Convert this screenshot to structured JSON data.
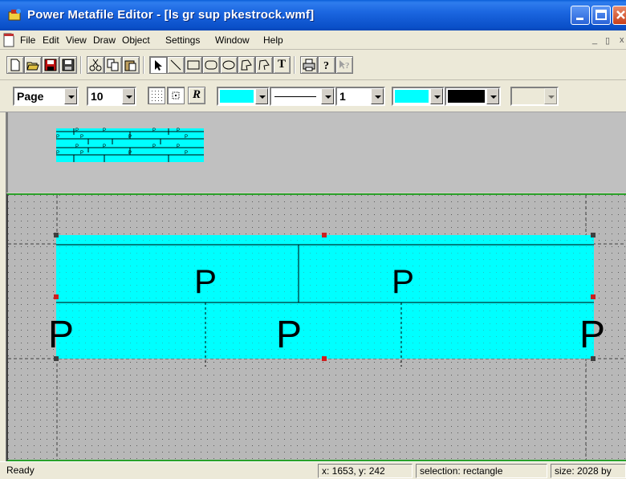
{
  "window": {
    "title": "Power Metafile Editor - [ls gr sup pkestrock.wmf]",
    "controls": [
      "minimize",
      "maximize",
      "close"
    ]
  },
  "menu": {
    "items": [
      "File",
      "Edit",
      "View",
      "Draw",
      "Object",
      "Settings",
      "Window",
      "Help"
    ],
    "mdi_controls": [
      "_",
      "⬚",
      "x"
    ]
  },
  "toolbar": {
    "file_icons": [
      "new-icon",
      "open-icon",
      "save-icon",
      "save-all-icon"
    ],
    "edit_icons": [
      "cut-icon",
      "copy-icon",
      "paste-icon"
    ],
    "draw_tools": [
      "select-arrow-icon",
      "line-tool-icon",
      "rectangle-tool-icon",
      "rounded-rect-tool-icon",
      "ellipse-tool-icon",
      "polygon-tool-icon",
      "polyline-tool-icon",
      "text-tool-icon"
    ],
    "misc_icons": [
      "print-icon",
      "help-icon",
      "context-help-icon"
    ],
    "text_tool_label": "T"
  },
  "format_bar": {
    "page_select": "Page",
    "size_select": "10",
    "italic_button": "R",
    "fill_color": "#00ffff",
    "line_style": "solid",
    "line_width": "1",
    "text_color": "#00ffff",
    "bg_color": "#000000"
  },
  "canvas": {
    "note_label": "P",
    "selection": "rectangle",
    "fill_color": "#00ffff",
    "handle_color_red": "#cc2020",
    "handle_color_dark": "#404040"
  },
  "status": {
    "ready": "Ready",
    "coords": "x: 1653, y: 242",
    "selection": "selection: rectangle",
    "size": "size: 2028 by"
  }
}
